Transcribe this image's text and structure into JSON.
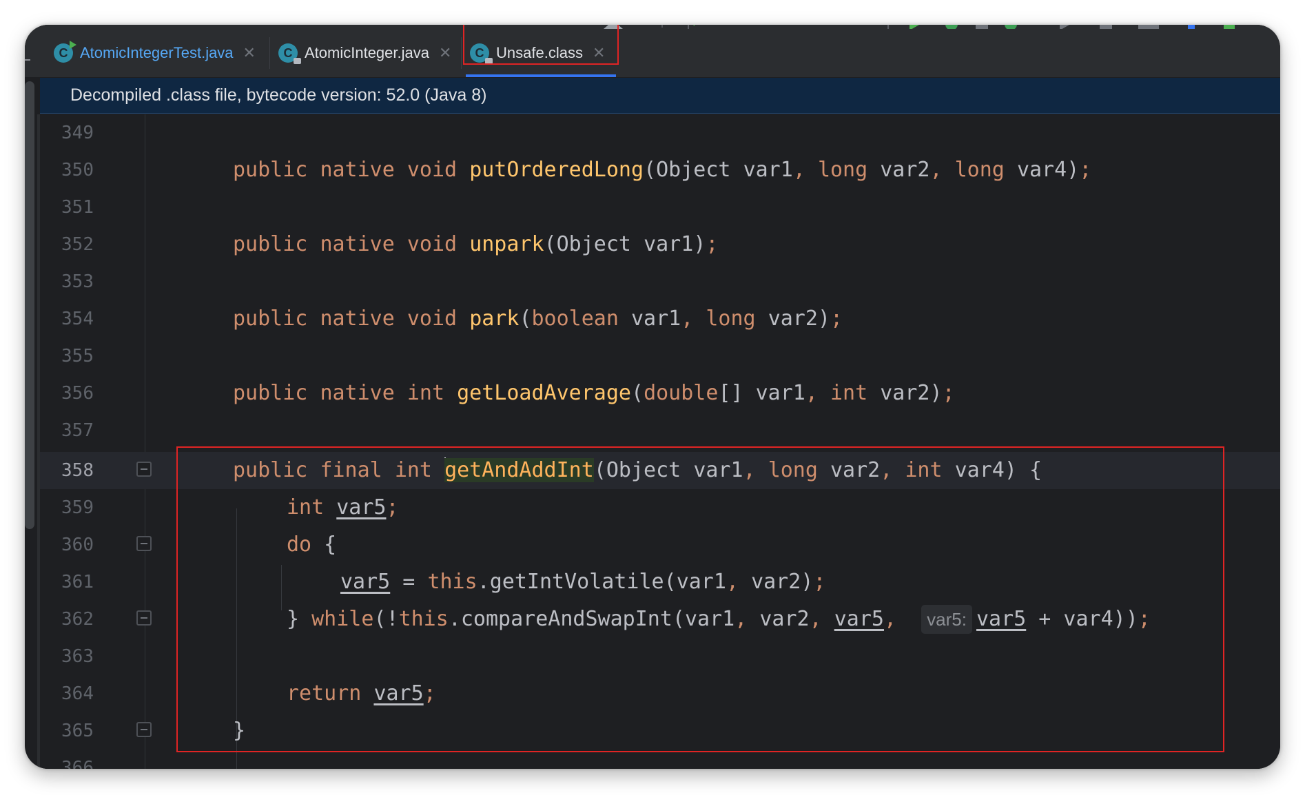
{
  "tabs": [
    {
      "label": "AtomicIntegerTest.java",
      "icon": "class-run-icon",
      "active": false,
      "color": "#56a8f5"
    },
    {
      "label": "AtomicInteger.java",
      "icon": "class-lock-icon",
      "active": false
    },
    {
      "label": "Unsafe.class",
      "icon": "class-lock-icon",
      "active": true
    }
  ],
  "banner": {
    "text": "Decompiled .class file, bytecode version: 52.0 (Java 8)"
  },
  "hint": {
    "label": "var5:"
  },
  "line_numbers": [
    "349",
    "350",
    "351",
    "352",
    "353",
    "354",
    "355",
    "356",
    "357",
    "358",
    "359",
    "360",
    "361",
    "362",
    "363",
    "364",
    "365",
    "366"
  ],
  "code": {
    "kw_public": "public",
    "kw_native": "native",
    "kw_void": "void",
    "kw_final": "final",
    "kw_int": "int",
    "kw_long": "long",
    "kw_boolean": "boolean",
    "kw_double": "double",
    "kw_do": "do",
    "kw_while": "while",
    "kw_this": "this",
    "kw_return": "return",
    "fn_putOrderedLong": "putOrderedLong",
    "fn_unpark": "unpark",
    "fn_park": "park",
    "fn_getLoadAverage": "getLoadAverage",
    "fn_getAndAddInt": "getAndAddInt",
    "fn_getIntVolatile": "getIntVolatile",
    "fn_compareAndSwapInt": "compareAndSwapInt",
    "t_Object": "Object",
    "v_var1": "var1",
    "v_var2": "var2",
    "v_var4": "var4",
    "v_var5": "var5"
  },
  "colors": {
    "keyword": "#cf8e6d",
    "method": "#56a8f5",
    "method_decl": "#ffc66d",
    "text": "#bcbec4",
    "highlight_box": "#e02424",
    "banner_bg": "#0f2742"
  }
}
